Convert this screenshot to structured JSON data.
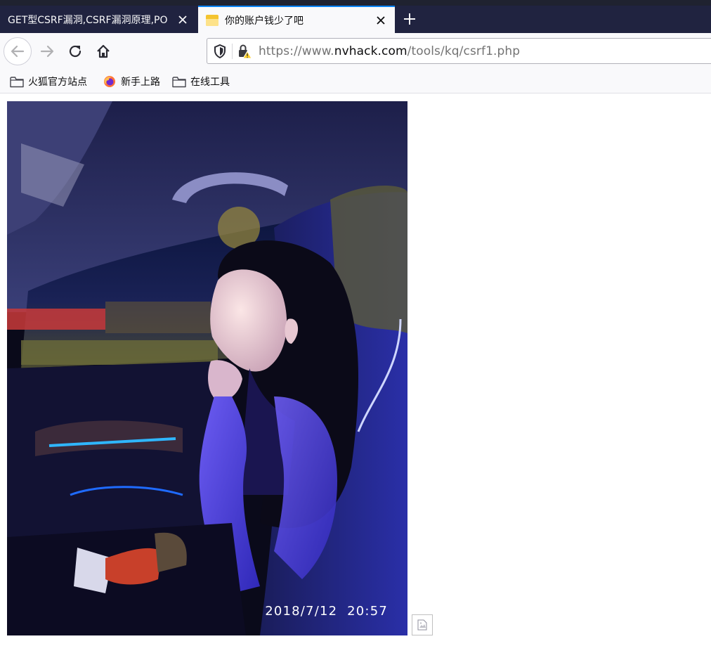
{
  "tabs": [
    {
      "title": "GET型CSRF漏洞,CSRF漏洞原理,PO",
      "active": false,
      "favicon": "none"
    },
    {
      "title": "你的账户钱少了吧",
      "active": true,
      "favicon": "folder-icon"
    }
  ],
  "nav": {
    "url_scheme": "https://www.",
    "url_host": "nvhack.com",
    "url_path": "/tools/kq/csrf1.php"
  },
  "bookmarks": [
    {
      "label": "火狐官方站点",
      "icon": "folder-icon"
    },
    {
      "label": "新手上路",
      "icon": "firefox-icon"
    },
    {
      "label": "在线工具",
      "icon": "folder-icon"
    }
  ],
  "page": {
    "photo_timestamp": "2018/7/12  20:57",
    "broken_image_icon": "broken-image-icon"
  },
  "colors": {
    "tabstrip": "#202340",
    "active_tab_accent": "#0a84ff",
    "toolbar": "#f9f9fb"
  }
}
